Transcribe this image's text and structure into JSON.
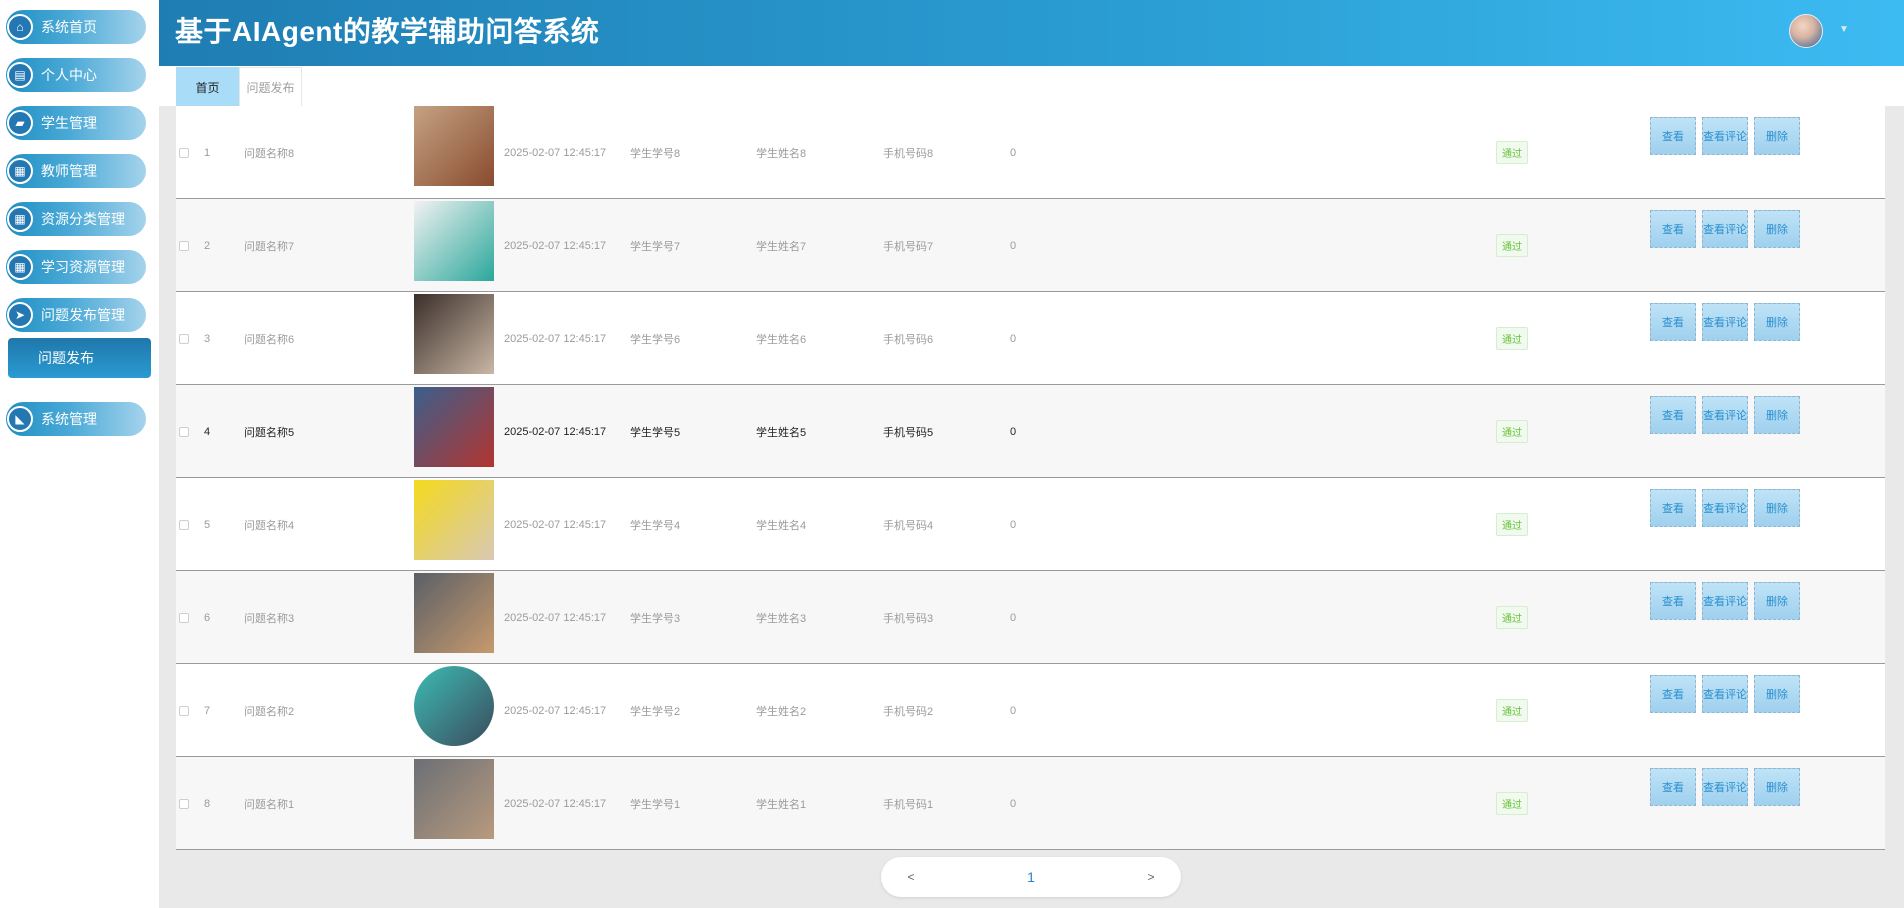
{
  "app": {
    "title": "基于AIAgent的教学辅助问答系统"
  },
  "sidebar": {
    "items": [
      {
        "label": "系统首页",
        "icon": "home-icon",
        "glyph": "⌂"
      },
      {
        "label": "个人中心",
        "icon": "profile-icon",
        "glyph": "▤"
      },
      {
        "label": "学生管理",
        "icon": "briefcase-icon",
        "glyph": "▰"
      },
      {
        "label": "教师管理",
        "icon": "grid-icon",
        "glyph": "▦"
      },
      {
        "label": "资源分类管理",
        "icon": "grid-icon",
        "glyph": "▦"
      },
      {
        "label": "学习资源管理",
        "icon": "grid-icon",
        "glyph": "▦"
      },
      {
        "label": "问题发布管理",
        "icon": "send-icon",
        "glyph": "➤"
      },
      {
        "label": "系统管理",
        "icon": "chart-icon",
        "glyph": "◣"
      }
    ],
    "sub_item": {
      "label": "问题发布"
    }
  },
  "tabs": [
    {
      "label": "首页",
      "active": true
    },
    {
      "label": "问题发布",
      "active": false
    }
  ],
  "table": {
    "rows": [
      {
        "index": "1",
        "name": "问题名称8",
        "time": "2025-02-07 12:45:17",
        "student_id": "学生学号8",
        "student_name": "学生姓名8",
        "phone": "手机号码8",
        "count": "0",
        "status": "通过",
        "thumb_colors": [
          "#c4a283",
          "#8a4b2f"
        ]
      },
      {
        "index": "2",
        "name": "问题名称7",
        "time": "2025-02-07 12:45:17",
        "student_id": "学生学号7",
        "student_name": "学生姓名7",
        "phone": "手机号码7",
        "count": "0",
        "status": "通过",
        "thumb_colors": [
          "#f2f2f2",
          "#2aa79b"
        ]
      },
      {
        "index": "3",
        "name": "问题名称6",
        "time": "2025-02-07 12:45:17",
        "student_id": "学生学号6",
        "student_name": "学生姓名6",
        "phone": "手机号码6",
        "count": "0",
        "status": "通过",
        "thumb_colors": [
          "#3b2f2a",
          "#c9b7a5"
        ]
      },
      {
        "index": "4",
        "name": "问题名称5",
        "time": "2025-02-07 12:45:17",
        "student_id": "学生学号5",
        "student_name": "学生姓名5",
        "phone": "手机号码5",
        "count": "0",
        "status": "通过",
        "thumb_colors": [
          "#3a5f8c",
          "#b3342f"
        ]
      },
      {
        "index": "5",
        "name": "问题名称4",
        "time": "2025-02-07 12:45:17",
        "student_id": "学生学号4",
        "student_name": "学生姓名4",
        "phone": "手机号码4",
        "count": "0",
        "status": "通过",
        "thumb_colors": [
          "#f3da1c",
          "#d9c8b5"
        ]
      },
      {
        "index": "6",
        "name": "问题名称3",
        "time": "2025-02-07 12:45:17",
        "student_id": "学生学号3",
        "student_name": "学生姓名3",
        "phone": "手机号码3",
        "count": "0",
        "status": "通过",
        "thumb_colors": [
          "#5a5f66",
          "#c79a6d"
        ]
      },
      {
        "index": "7",
        "name": "问题名称2",
        "time": "2025-02-07 12:45:17",
        "student_id": "学生学号2",
        "student_name": "学生姓名2",
        "phone": "手机号码2",
        "count": "0",
        "status": "通过",
        "thumb_colors": [
          "#3dbcb4",
          "#3a4a5c"
        ]
      },
      {
        "index": "8",
        "name": "问题名称1",
        "time": "2025-02-07 12:45:17",
        "student_id": "学生学号1",
        "student_name": "学生姓名1",
        "phone": "手机号码1",
        "count": "0",
        "status": "通过",
        "thumb_colors": [
          "#6b6f75",
          "#b89a7e"
        ]
      }
    ],
    "actions": {
      "view": "查看",
      "view_comments": "查看评论",
      "delete": "删除"
    }
  },
  "pagination": {
    "prev": "<",
    "current": "1",
    "next": ">"
  },
  "colors": {
    "accent": "#2a9dd2",
    "status_green": "#67c23a"
  }
}
